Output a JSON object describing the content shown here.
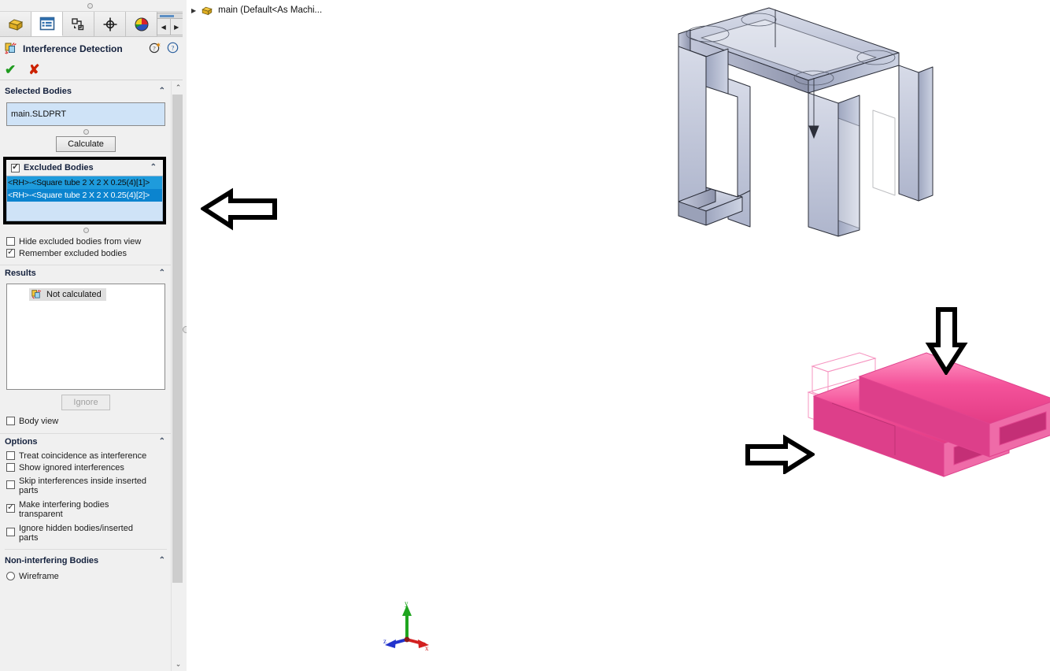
{
  "window": {
    "title": "Interference Detection"
  },
  "tabs": [
    {
      "name": "feature-manager-design-tree",
      "icon": "yellow-part-tree-icon",
      "active": false
    },
    {
      "name": "property-manager",
      "icon": "blue-list-icon",
      "active": true
    },
    {
      "name": "configuration-manager",
      "icon": "configuration-icon",
      "active": false
    },
    {
      "name": "dimxpert-manager",
      "icon": "target-crosshair-icon",
      "active": false
    },
    {
      "name": "display-manager",
      "icon": "color-sphere-icon",
      "active": false
    }
  ],
  "tab_scroll": {
    "left": "◀",
    "right": "▶"
  },
  "property_manager": {
    "title": "Interference Detection",
    "help_icons": [
      "whats-new-help-icon",
      "help-icon"
    ],
    "ok_label": "✔",
    "cancel_label": "✘",
    "selected_bodies": {
      "heading": "Selected Bodies",
      "value": "main.SLDPRT",
      "calculate_label": "Calculate"
    },
    "excluded_bodies": {
      "heading": "Excluded Bodies",
      "checked": true,
      "items": [
        "<RH>-<Square tube 2 X 2 X 0.25(4)[1]>",
        "<RH>-<Square tube 2 X 2 X 0.25(4)[2]>"
      ],
      "options": [
        {
          "label": "Hide excluded bodies from view",
          "checked": false
        },
        {
          "label": "Remember excluded bodies",
          "checked": true
        }
      ]
    },
    "results": {
      "heading": "Results",
      "status": "Not calculated",
      "status_icon": "interference-icon",
      "ignore_label": "Ignore",
      "ignore_disabled": true,
      "body_view": {
        "label": "Body view",
        "checked": false
      }
    },
    "options": {
      "heading": "Options",
      "items": [
        {
          "label": "Treat coincidence as interference",
          "checked": false
        },
        {
          "label": "Show ignored interferences",
          "checked": false
        },
        {
          "label": "Skip interferences inside inserted parts",
          "checked": false
        },
        {
          "label": "Make interfering bodies transparent",
          "checked": true
        },
        {
          "label": "Ignore hidden bodies/inserted parts",
          "checked": false
        }
      ]
    },
    "non_interfering_bodies": {
      "heading": "Non-interfering Bodies",
      "items": [
        {
          "label": "Wireframe",
          "selected": false
        }
      ]
    }
  },
  "tree": {
    "expander": "▶",
    "icon": "part-document-icon",
    "label": "main  (Default<As Machi..."
  },
  "graphics": {
    "annotations": [
      {
        "name": "arrow-to-excluded-bodies",
        "direction": "left"
      },
      {
        "name": "arrow-to-pink-bodies-top",
        "direction": "down"
      },
      {
        "name": "arrow-to-pink-bodies-side",
        "direction": "right"
      }
    ],
    "triad": {
      "x_label": "x",
      "y_label": "y",
      "z_label": "z"
    },
    "colors": {
      "excluded_body": "#f46ba8",
      "frame_body": "#b8bed4",
      "triad_x": "#d32020",
      "triad_y": "#1fa51f",
      "triad_z": "#2233cc"
    }
  }
}
